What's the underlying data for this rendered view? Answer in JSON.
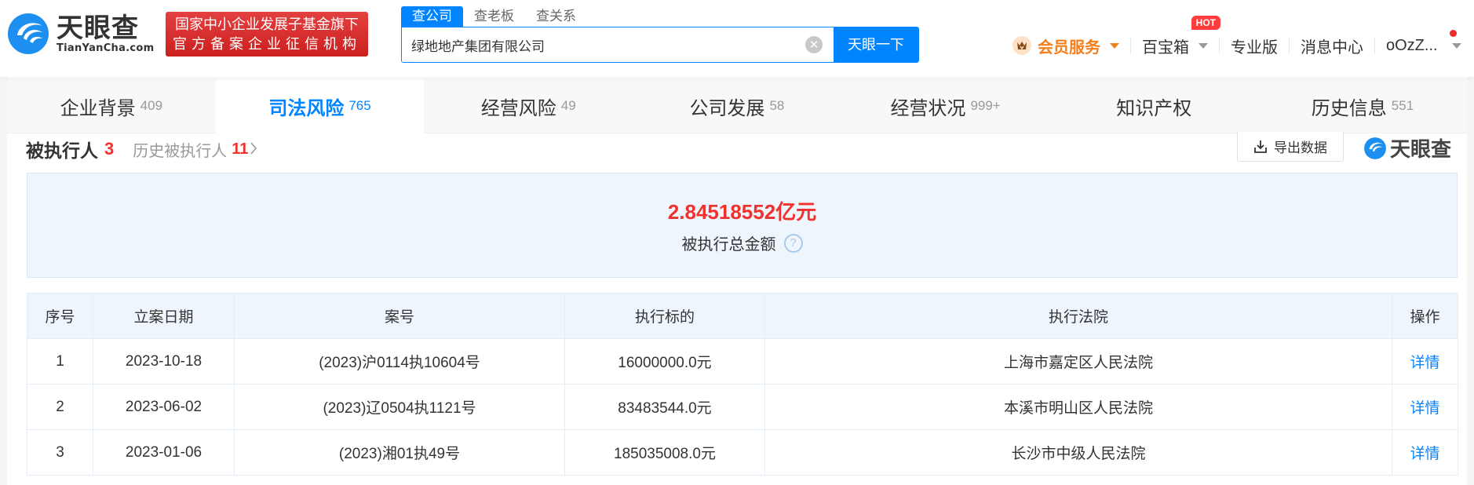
{
  "header": {
    "logo": {
      "cn": "天眼查",
      "en": "TianYanCha.com"
    },
    "badge": {
      "line1": "国家中小企业发展子基金旗下",
      "line2": "官方备案企业征信机构"
    },
    "search_tabs": [
      {
        "label": "查公司",
        "active": true
      },
      {
        "label": "查老板",
        "active": false
      },
      {
        "label": "查关系",
        "active": false
      }
    ],
    "search": {
      "value": "绿地地产集团有限公司",
      "button_label": "天眼一下"
    },
    "nav": {
      "vip_label": "会员服务",
      "toolbox_label": "百宝箱",
      "hot_label": "HOT",
      "pro_label": "专业版",
      "messages_label": "消息中心",
      "user_label": "oOzZ..."
    }
  },
  "tabs": [
    {
      "label": "企业背景",
      "count": "409",
      "active": false
    },
    {
      "label": "司法风险",
      "count": "765",
      "active": true
    },
    {
      "label": "经营风险",
      "count": "49",
      "active": false
    },
    {
      "label": "公司发展",
      "count": "58",
      "active": false
    },
    {
      "label": "经营状况",
      "count": "999+",
      "active": false
    },
    {
      "label": "知识产权",
      "count": "",
      "active": false
    },
    {
      "label": "历史信息",
      "count": "551",
      "active": false
    }
  ],
  "section": {
    "title": "被执行人",
    "count": "3",
    "history_label": "历史被执行人",
    "history_count": "11",
    "export_label": "导出数据",
    "watermark": "天眼查"
  },
  "summary": {
    "amount": "2.84518552亿元",
    "label": "被执行总金额",
    "help": "?"
  },
  "table": {
    "headers": [
      "序号",
      "立案日期",
      "案号",
      "执行标的",
      "执行法院",
      "操作"
    ],
    "rows": [
      {
        "no": "1",
        "date": "2023-10-18",
        "case": "(2023)沪0114执10604号",
        "amount": "16000000.0元",
        "court": "上海市嘉定区人民法院",
        "action": "详情"
      },
      {
        "no": "2",
        "date": "2023-06-02",
        "case": "(2023)辽0504执1121号",
        "amount": "83483544.0元",
        "court": "本溪市明山区人民法院",
        "action": "详情"
      },
      {
        "no": "3",
        "date": "2023-01-06",
        "case": "(2023)湘01执49号",
        "amount": "185035008.0元",
        "court": "长沙市中级人民法院",
        "action": "详情"
      }
    ]
  },
  "colors": {
    "brand_blue": "#0084ff",
    "alert_red": "#f0312d",
    "vip_orange": "#f57e1c"
  }
}
